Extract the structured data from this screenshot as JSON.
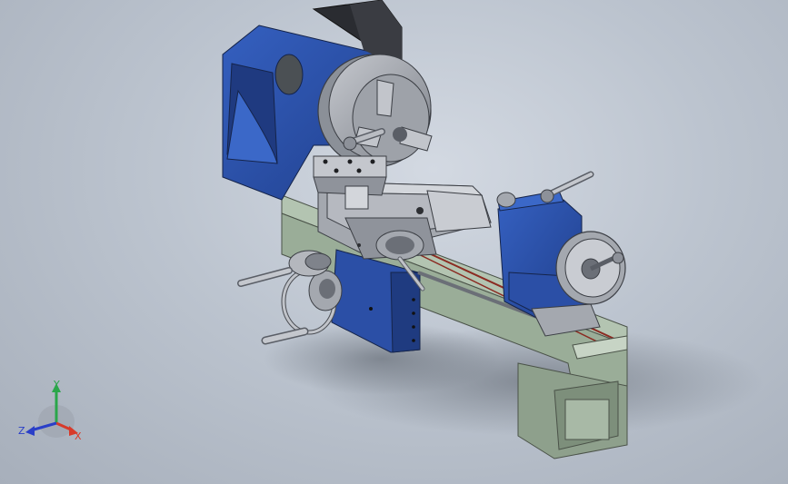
{
  "triad": {
    "x_label": "X",
    "y_label": "Y",
    "z_label": "Z",
    "colors": {
      "x": "#d83a2a",
      "y": "#2aa64a",
      "z": "#2a3fc8"
    }
  },
  "model": {
    "colors": {
      "headstock_blue": "#2b4fa6",
      "bed_green": "#9aad98",
      "steel": "#a2a6ad",
      "dark_steel": "#6b6f77",
      "chuck": "#8e929a"
    }
  }
}
